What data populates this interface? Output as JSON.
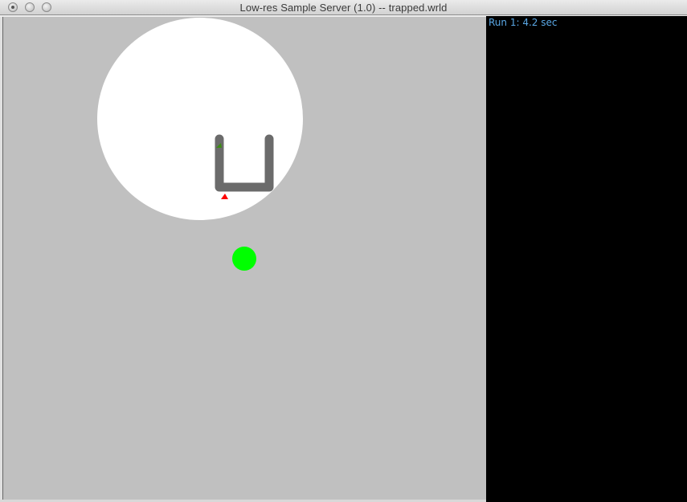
{
  "window": {
    "title": "Low-res Sample Server (1.0) -- trapped.wrld"
  },
  "status": {
    "run_label": "Run 1: 4.2 sec"
  },
  "colors": {
    "world_background": "#c0c0c0",
    "light_area": "#ffffff",
    "wall": "#6b6b6b",
    "goal": "#00ff00",
    "robot": "#ff0000",
    "sensor_mark": "#3c8c14",
    "status_text": "#5aa8e6"
  },
  "icons": {
    "close": "close-dot-icon",
    "minimize": "minimize-dot-icon",
    "zoom": "zoom-dot-icon"
  }
}
